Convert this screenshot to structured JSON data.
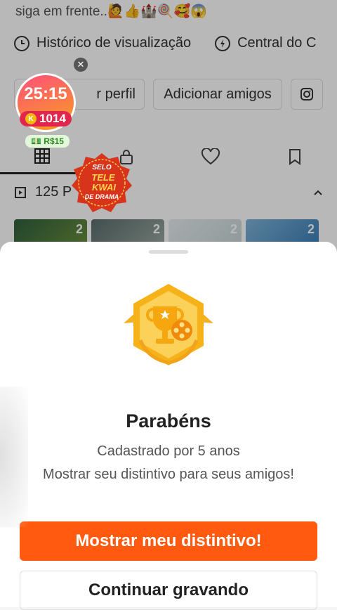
{
  "profile": {
    "bio": "siga em frente..🙋👍🏰🍭🥰😱",
    "quick_links": [
      {
        "icon": "clock-icon",
        "label": "Histórico de visualização"
      },
      {
        "icon": "bolt-icon",
        "label": "Central do C"
      }
    ],
    "buttons": {
      "edit_profile": "r perfil",
      "add_friends": "Adicionar amigos",
      "instagram_icon": "instagram-icon"
    },
    "collections": {
      "label": "125 P"
    }
  },
  "timer_widget": {
    "time": "25:15",
    "coins": "1014",
    "money": "R$15"
  },
  "seal": {
    "line1": "SELO",
    "line2": "TELE",
    "line3": "KWAI",
    "line4": "DE DRAMA"
  },
  "thumbs": [
    {
      "count": "2"
    },
    {
      "count": "2"
    },
    {
      "count": "2"
    },
    {
      "count": "2"
    }
  ],
  "sheet": {
    "title": "Parabéns",
    "subtitle": "Cadastrado por 5 anos",
    "message": "Mostrar seu distintivo para seus amigos!",
    "primary_button": "Mostrar meu distintivo!",
    "secondary_button": "Continuar gravando"
  },
  "colors": {
    "accent": "#ff5a0f",
    "badge": "#f7b21a"
  }
}
